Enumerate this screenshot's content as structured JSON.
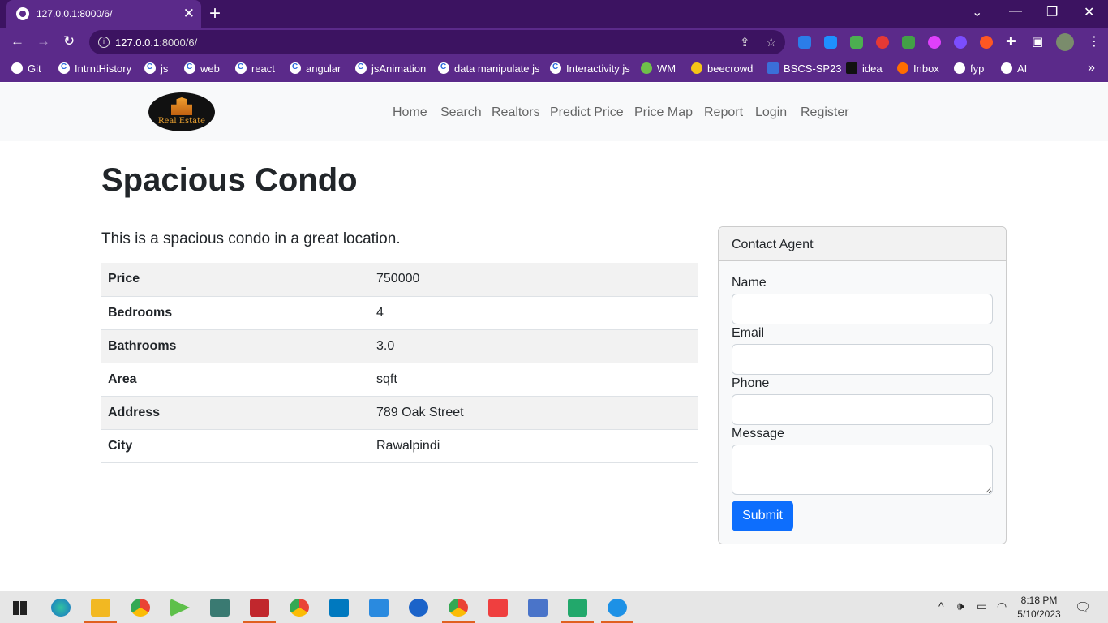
{
  "browser": {
    "tab_title": "127.0.0.1:8000/6/",
    "tab_close": "✕",
    "new_tab": "+",
    "url_host": "127.0.0.1",
    "url_rest": ":8000/6/",
    "back_icon": "arrow-left-icon",
    "forward_icon": "arrow-right-icon",
    "reload_icon": "reload-icon",
    "bookmarks": [
      "Git",
      "IntrntHistory",
      "js",
      "web",
      "react",
      "angular",
      "jsAnimation",
      "data manipulate js",
      "Interactivity js",
      "WM",
      "beecrowd",
      "BSCS-SP23",
      "idea",
      "Inbox",
      "fyp",
      "AI"
    ],
    "bookmarks_more": "»"
  },
  "site": {
    "logo_text": "Real Estate",
    "nav": [
      "Home",
      "Search",
      "Realtors",
      "Predict Price",
      "Price Map",
      "Report",
      "Login",
      "Register"
    ]
  },
  "listing": {
    "title": "Spacious Condo",
    "description": "This is a spacious condo in a great location.",
    "details": [
      {
        "label": "Price",
        "value": "750000"
      },
      {
        "label": "Bedrooms",
        "value": "4"
      },
      {
        "label": "Bathrooms",
        "value": "3.0"
      },
      {
        "label": "Area",
        "value": "sqft"
      },
      {
        "label": "Address",
        "value": "789 Oak Street"
      },
      {
        "label": "City",
        "value": "Rawalpindi"
      }
    ]
  },
  "contact": {
    "header": "Contact Agent",
    "name_label": "Name",
    "email_label": "Email",
    "phone_label": "Phone",
    "message_label": "Message",
    "submit_label": "Submit"
  },
  "taskbar": {
    "time": "8:18 PM",
    "date": "5/10/2023"
  },
  "colors": {
    "chrome_dark": "#3c1361",
    "chrome": "#5b2a8a",
    "primary": "#0d6efd"
  }
}
